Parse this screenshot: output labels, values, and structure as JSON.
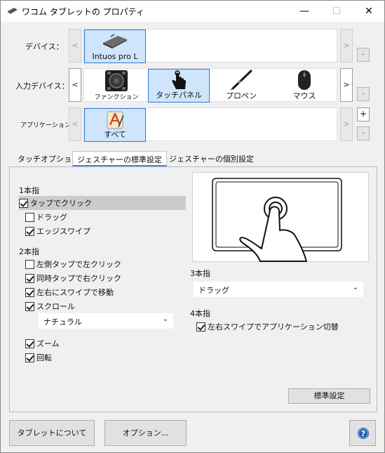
{
  "window": {
    "title": "ワコム タブレットの プロパティ",
    "controls": {
      "minimize": "—",
      "maximize": "☐",
      "close": "✕"
    }
  },
  "rows": {
    "device": {
      "label": "デバイス：",
      "items": [
        {
          "label": "Intuos pro L",
          "icon": "tablet-icon",
          "selected": true
        }
      ]
    },
    "input_device": {
      "label": "入力デバイス：",
      "items": [
        {
          "label": "ファンクション",
          "icon": "function-icon",
          "selected": false
        },
        {
          "label": "タッチパネル",
          "icon": "touch-hand-icon",
          "selected": true
        },
        {
          "label": "プロペン",
          "icon": "pen-icon",
          "selected": false
        },
        {
          "label": "マウス",
          "icon": "mouse-icon",
          "selected": false
        }
      ]
    },
    "application": {
      "label": "アプリケーション：",
      "items": [
        {
          "label": "すべて",
          "icon": "all-apps-icon",
          "selected": true
        }
      ]
    }
  },
  "nav": {
    "left": "<",
    "right": ">",
    "plus": "+",
    "minus": "-"
  },
  "tabs": [
    {
      "label": "タッチオプション",
      "selected": false
    },
    {
      "label": "ジェスチャーの標準設定",
      "selected": true
    },
    {
      "label": "ジェスチャーの個別設定",
      "selected": false
    }
  ],
  "gestures": {
    "one_finger": {
      "title": "1本指",
      "options": [
        {
          "label": "タップでクリック",
          "checked": true
        },
        {
          "label": "ドラッグ",
          "checked": false
        },
        {
          "label": "エッジスワイプ",
          "checked": true
        }
      ]
    },
    "two_finger": {
      "title": "2本指",
      "options": [
        {
          "label": "左側タップで左クリック",
          "checked": false
        },
        {
          "label": "同時タップで右クリック",
          "checked": true
        },
        {
          "label": "左右にスワイプで移動",
          "checked": true
        },
        {
          "label": "スクロール",
          "checked": true
        }
      ],
      "scroll_select": "ナチュラル",
      "extra_options": [
        {
          "label": "ズーム",
          "checked": true
        },
        {
          "label": "回転",
          "checked": true
        }
      ]
    },
    "three_finger": {
      "title": "3本指",
      "select": "ドラッグ"
    },
    "four_finger": {
      "title": "4本指",
      "options": [
        {
          "label": "左右スワイプでアプリケーション切替",
          "checked": true
        }
      ]
    },
    "defaults_button": "標準設定"
  },
  "footer": {
    "about_button": "タブレットについて",
    "options_button": "オプション...",
    "help_icon": "help-icon"
  },
  "colors": {
    "selection_fill": "#cfe5fb",
    "selection_border": "#2f7bd6",
    "tab_underline": "#3a8de3",
    "help_blue": "#1f5fb0"
  }
}
